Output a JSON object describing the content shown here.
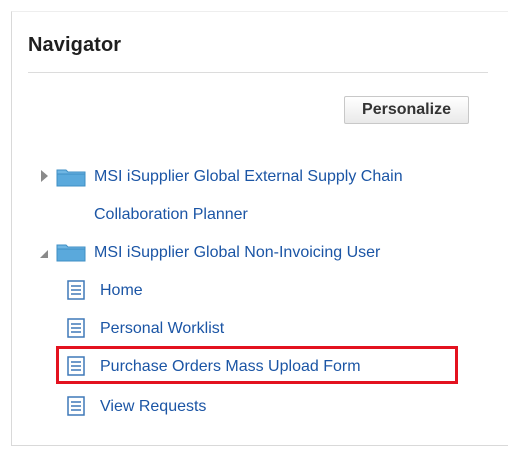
{
  "navigator": {
    "title": "Navigator",
    "personalize_label": "Personalize",
    "groups": [
      {
        "label_line1": "MSI iSupplier Global External Supply Chain",
        "label_line2": "Collaboration Planner",
        "expanded": false
      },
      {
        "label": "MSI iSupplier Global Non-Invoicing User",
        "expanded": true,
        "items": [
          {
            "label": "Home"
          },
          {
            "label": "Personal Worklist"
          },
          {
            "label": "Purchase Orders Mass Upload Form"
          },
          {
            "label": "View Requests"
          }
        ]
      }
    ]
  },
  "colors": {
    "link": "#1b55a5",
    "highlight": "#e3121f",
    "folder": "#5aa9dc"
  },
  "icons": {
    "collapsed": "chevron-right-icon",
    "expanded": "chevron-down-icon",
    "group": "folder-icon",
    "item": "document-icon"
  }
}
